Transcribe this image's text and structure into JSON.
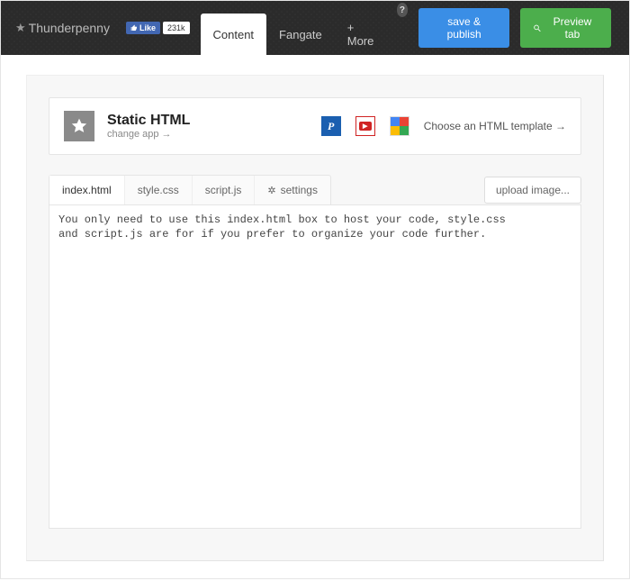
{
  "topbar": {
    "brand": "Thunderpenny",
    "fb_like_label": "Like",
    "fb_like_count": "231k",
    "nav": [
      {
        "label": "Content",
        "active": true
      },
      {
        "label": "Fangate",
        "active": false
      },
      {
        "label": "+ More",
        "active": false
      }
    ],
    "save_publish": "save & publish",
    "preview_tab": "Preview tab"
  },
  "header": {
    "title": "Static HTML",
    "change_app": "change app →",
    "choose_template": "Choose an HTML template →"
  },
  "tabs": {
    "items": [
      {
        "label": "index.html",
        "active": true
      },
      {
        "label": "style.css",
        "active": false
      },
      {
        "label": "script.js",
        "active": false
      },
      {
        "label": "settings",
        "active": false,
        "icon": "gear"
      }
    ],
    "upload_image": "upload image..."
  },
  "editor": {
    "content": "You only need to use this index.html box to host your code, style.css\nand script.js are for if you prefer to organize your code further."
  }
}
